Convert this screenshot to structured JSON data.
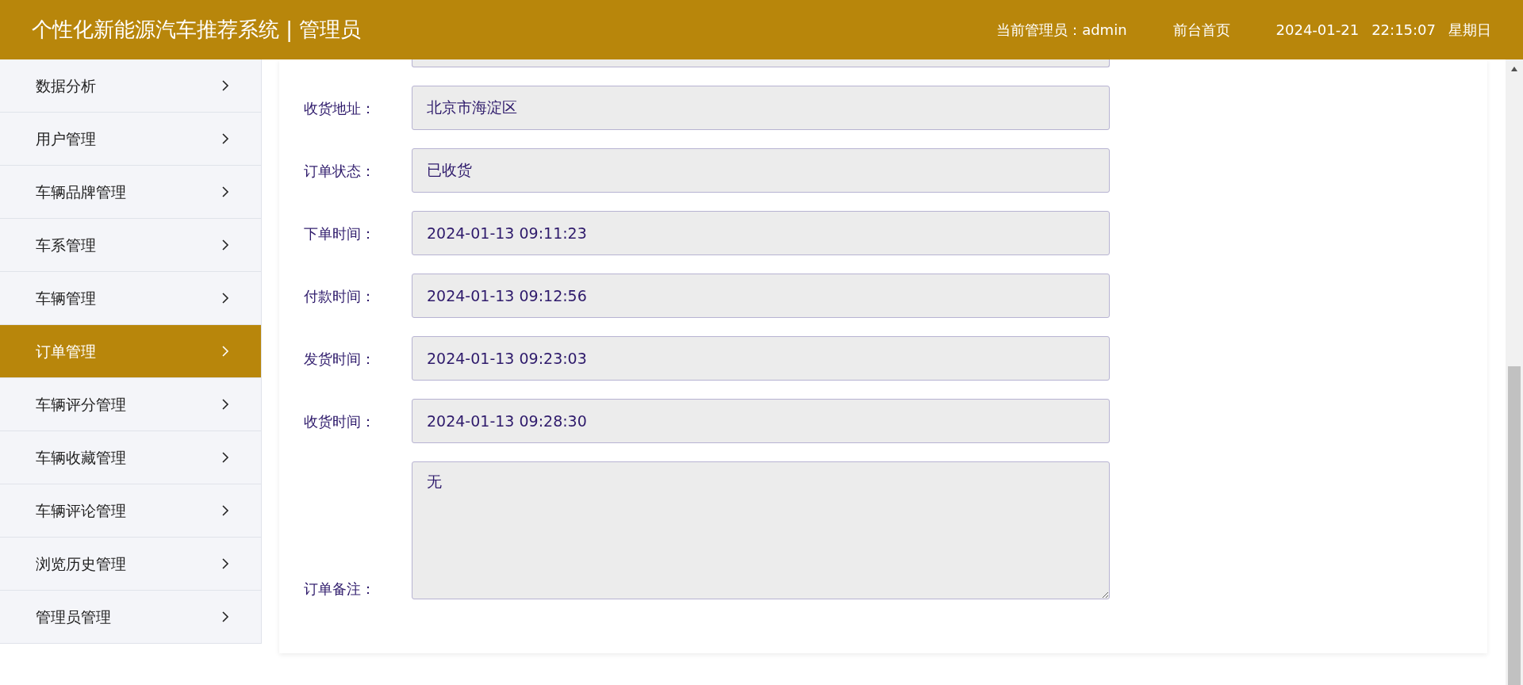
{
  "header": {
    "title": "个性化新能源汽车推荐系统 | 管理员",
    "admin_label": "当前管理员：admin",
    "home_link": "前台首页",
    "date": "2024-01-21",
    "time": "22:15:07",
    "weekday": "星期日"
  },
  "sidebar": {
    "items": [
      {
        "label": "数据分析",
        "selected": false
      },
      {
        "label": "用户管理",
        "selected": false
      },
      {
        "label": "车辆品牌管理",
        "selected": false
      },
      {
        "label": "车系管理",
        "selected": false
      },
      {
        "label": "车辆管理",
        "selected": false
      },
      {
        "label": "订单管理",
        "selected": true
      },
      {
        "label": "车辆评分管理",
        "selected": false
      },
      {
        "label": "车辆收藏管理",
        "selected": false
      },
      {
        "label": "车辆评论管理",
        "selected": false
      },
      {
        "label": "浏览历史管理",
        "selected": false
      },
      {
        "label": "管理员管理",
        "selected": false
      }
    ]
  },
  "form": {
    "fields": [
      {
        "label": "收货地址：",
        "value": "北京市海淀区",
        "kind": "input"
      },
      {
        "label": "订单状态：",
        "value": "已收货",
        "kind": "input"
      },
      {
        "label": "下单时间：",
        "value": "2024-01-13 09:11:23",
        "kind": "input"
      },
      {
        "label": "付款时间：",
        "value": "2024-01-13 09:12:56",
        "kind": "input"
      },
      {
        "label": "发货时间：",
        "value": "2024-01-13 09:23:03",
        "kind": "input"
      },
      {
        "label": "收货时间：",
        "value": "2024-01-13 09:28:30",
        "kind": "input"
      },
      {
        "label": "订单备注：",
        "value": "无",
        "kind": "textarea"
      }
    ]
  }
}
